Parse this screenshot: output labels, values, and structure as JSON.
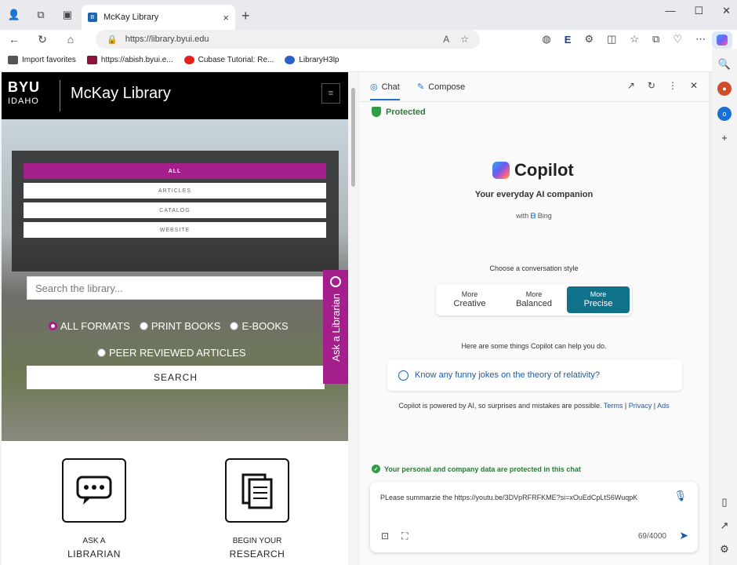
{
  "browser": {
    "tab_title": "McKay Library",
    "tab_close": "×",
    "new_tab": "+",
    "url": "https://library.byui.edu",
    "window_controls": [
      "—",
      "☐",
      "✕"
    ]
  },
  "favorites": [
    {
      "label": "Import favorites",
      "color": "#555555"
    },
    {
      "label": "https://abish.byui.e...",
      "color": "#8a1538"
    },
    {
      "label": "Cubase Tutorial: Re...",
      "color": "#e62117"
    },
    {
      "label": "LibraryH3lp",
      "color": "#2a60c9"
    }
  ],
  "site": {
    "logo_top": "BYU",
    "logo_bottom": "IDAHO",
    "name": "McKay Library",
    "menu_icon": "≡",
    "search_tabs": [
      "ALL",
      "ARTICLES",
      "CATALOG",
      "WEBSITE"
    ],
    "search_placeholder": "Search the library...",
    "formats_row1": [
      "ALL FORMATS",
      "PRINT BOOKS",
      "E-BOOKS"
    ],
    "formats_row2": [
      "PEER REVIEWED ARTICLES"
    ],
    "search_button": "SEARCH",
    "ask_tab": "Ask a Librarian",
    "tiles": [
      {
        "line1": "ASK A",
        "line2": "LIBRARIAN"
      },
      {
        "line1": "BEGIN YOUR",
        "line2": "RESEARCH"
      }
    ],
    "accent": "#a41e8c"
  },
  "copilot": {
    "tabs": [
      "Chat",
      "Compose"
    ],
    "protected": "Protected",
    "brand": "Copilot",
    "tagline": "Your everyday AI companion",
    "with_label": "with",
    "bing": "Bing",
    "style_prompt": "Choose a conversation style",
    "styles": [
      {
        "top": "More",
        "bottom": "Creative"
      },
      {
        "top": "More",
        "bottom": "Balanced"
      },
      {
        "top": "More",
        "bottom": "Precise"
      }
    ],
    "help_text": "Here are some things Copilot can help you do.",
    "suggestion": "Know any funny jokes on the theory of relativity?",
    "powered_text": "Copilot is powered by AI, so surprises and mistakes are possible.",
    "links": [
      "Terms",
      "Privacy",
      "Ads"
    ],
    "privacy_note": "Your personal and company data are protected in this chat",
    "input_value": "PLease summarzie the https://youtu.be/3DVpRFRFKME?si=xOuEdCpLtS6WuqpK",
    "counter": "69/4000",
    "accent": "#10718a"
  }
}
